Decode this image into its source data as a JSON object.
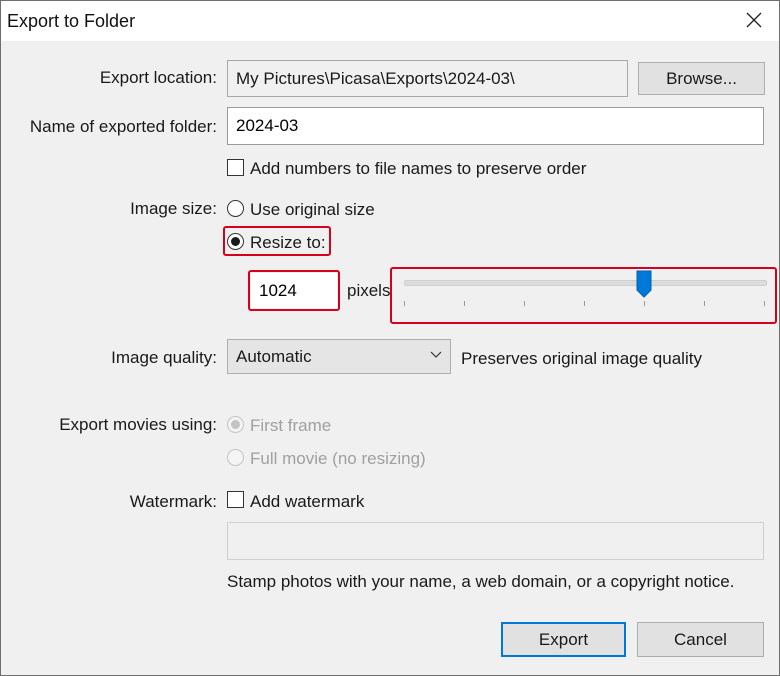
{
  "window": {
    "title": "Export to Folder",
    "close_icon": "close-icon"
  },
  "export_location": {
    "label": "Export location:",
    "value": "My Pictures\\Picasa\\Exports\\2024-03\\",
    "browse_label": "Browse..."
  },
  "folder_name": {
    "label": "Name of exported folder:",
    "value": "2024-03"
  },
  "add_numbers": {
    "label": "Add numbers to file names to preserve order",
    "checked": false
  },
  "image_size": {
    "label": "Image size:",
    "options": [
      {
        "label": "Use original size",
        "selected": false
      },
      {
        "label": "Resize to:",
        "selected": true
      }
    ],
    "pixels_value": "1024",
    "pixels_unit": "pixels",
    "slider": {
      "tick_count": 7,
      "position_index": 4,
      "fraction": 0.6667
    }
  },
  "image_quality": {
    "label": "Image quality:",
    "selected": "Automatic",
    "description": "Preserves original image quality"
  },
  "export_movies": {
    "label": "Export movies using:",
    "options": [
      {
        "label": "First frame",
        "selected": true,
        "disabled": true
      },
      {
        "label": "Full movie (no resizing)",
        "selected": false,
        "disabled": true
      }
    ]
  },
  "watermark": {
    "label": "Watermark:",
    "checkbox_label": "Add watermark",
    "checked": false,
    "text_value": "",
    "hint": "Stamp photos with your name, a web domain, or a copyright notice."
  },
  "buttons": {
    "export": "Export",
    "cancel": "Cancel"
  },
  "colors": {
    "highlight": "#d6001c",
    "accent": "#0078d7"
  }
}
